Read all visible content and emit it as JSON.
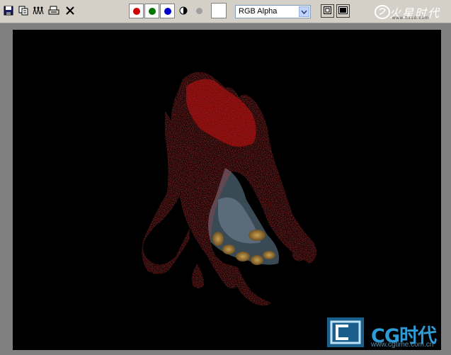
{
  "toolbar": {
    "icons": [
      "save-icon",
      "clone-icon",
      "channels-icon",
      "print-icon",
      "close-icon"
    ],
    "channels": [
      {
        "name": "red",
        "color": "#cc0000"
      },
      {
        "name": "green",
        "color": "#007700"
      },
      {
        "name": "blue",
        "color": "#0000cc"
      }
    ],
    "mono_icon": "half-circle-icon",
    "gray_dot_color": "#a0a0a0",
    "swatch_color": "#ffffff",
    "channel_select": {
      "value": "RGB Alpha"
    },
    "view_buttons": [
      "display-icon",
      "display-dark-icon"
    ],
    "logo_icon": "snake-logo-icon",
    "logo_text": "火星时代",
    "logo_url": "www.hxsd.com"
  },
  "watermark": {
    "title": "CG时代",
    "url": "www.cgtime.com.cn",
    "primary_color": "#2f9bd6"
  },
  "render": {
    "subject": "dissolving red particle foot",
    "background_color": "#000000",
    "particle_color": "#cc1111",
    "skin_color": "#b08a3a"
  }
}
